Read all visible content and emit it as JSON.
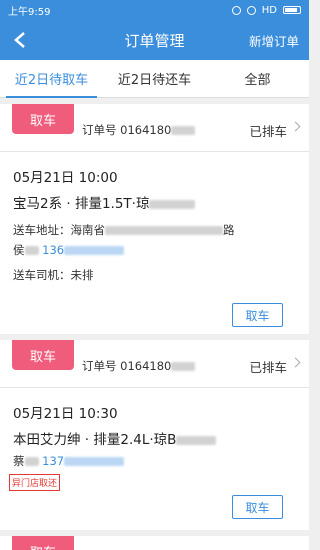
{
  "status_bar": {
    "time": "上午9:59",
    "network": "HD"
  },
  "nav": {
    "title": "订单管理",
    "action": "新增订单"
  },
  "tabs": [
    "近2日待取车",
    "近2日待还车",
    "全部"
  ],
  "orders": [
    {
      "tag": "取车",
      "order_prefix": "订单号 0164180",
      "status": "已排车",
      "datetime": "05月21日 10:00",
      "car": "宝马2系 · 排量1.5T·琼",
      "address_label": "送车地址：海南省",
      "address_suffix": "路",
      "customer_initial": "侯",
      "phone_prefix": "136",
      "driver": "送车司机：未排",
      "button": "取车"
    },
    {
      "tag": "取车",
      "order_prefix": "订单号 0164180",
      "status": "已排车",
      "datetime": "05月21日 10:30",
      "car": "本田艾力绅 · 排量2.4L·琼B",
      "customer_initial": "蔡",
      "phone_prefix": "137",
      "note": "异门店取还",
      "button": "取车"
    },
    {
      "tag": "取车"
    }
  ]
}
